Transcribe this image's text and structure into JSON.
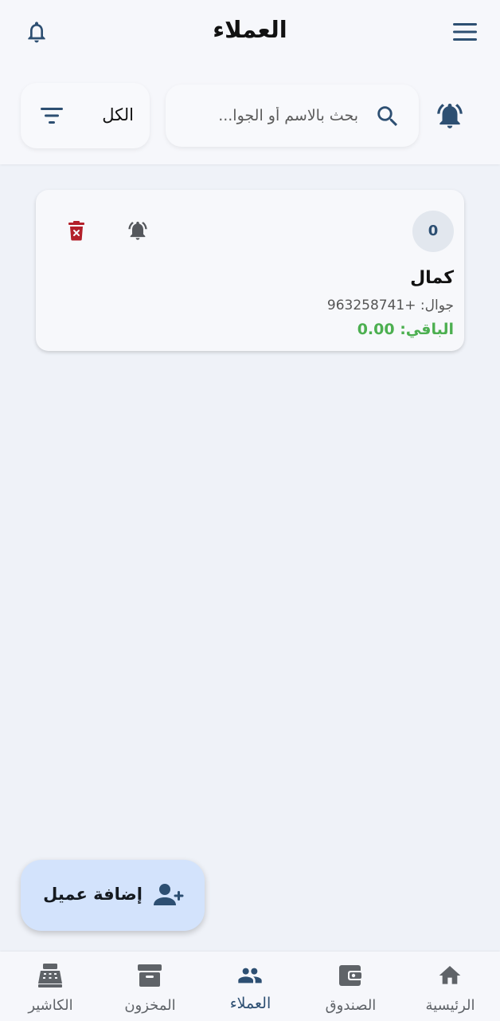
{
  "app_bar": {
    "title": "العملاء",
    "menu_icon": "menu-icon",
    "bell_icon": "bell-outline-icon"
  },
  "search": {
    "placeholder": "بحث بالاسم أو الجوا...",
    "value": "",
    "search_icon": "search-icon",
    "alarm_icon": "alarm-bell-icon"
  },
  "filter": {
    "selected": "الكل",
    "icon": "filter-icon"
  },
  "customers": [
    {
      "count": "0",
      "name": "كمال",
      "phone": "جوال: +963258741",
      "balance": "الباقي: 0.00",
      "alarm_icon": "alarm-bell-icon",
      "delete_icon": "trash-icon"
    }
  ],
  "fab": {
    "label": "إضافة عميل",
    "icon": "person-add-icon"
  },
  "bottom_nav": {
    "items": [
      {
        "label": "الرئيسية",
        "icon": "home-icon",
        "active": false
      },
      {
        "label": "الصندوق",
        "icon": "wallet-icon",
        "active": false
      },
      {
        "label": "العملاء",
        "icon": "people-icon",
        "active": true
      },
      {
        "label": "المخزون",
        "icon": "archive-box-icon",
        "active": false
      },
      {
        "label": "الكاشير",
        "icon": "cash-register-icon",
        "active": false
      }
    ]
  },
  "colors": {
    "primary": "#2d4f72",
    "balance_green": "#4caf50",
    "delete_red": "#b3202a",
    "fab_bg": "#d3e3fc",
    "page_bg": "#eff2f8"
  }
}
